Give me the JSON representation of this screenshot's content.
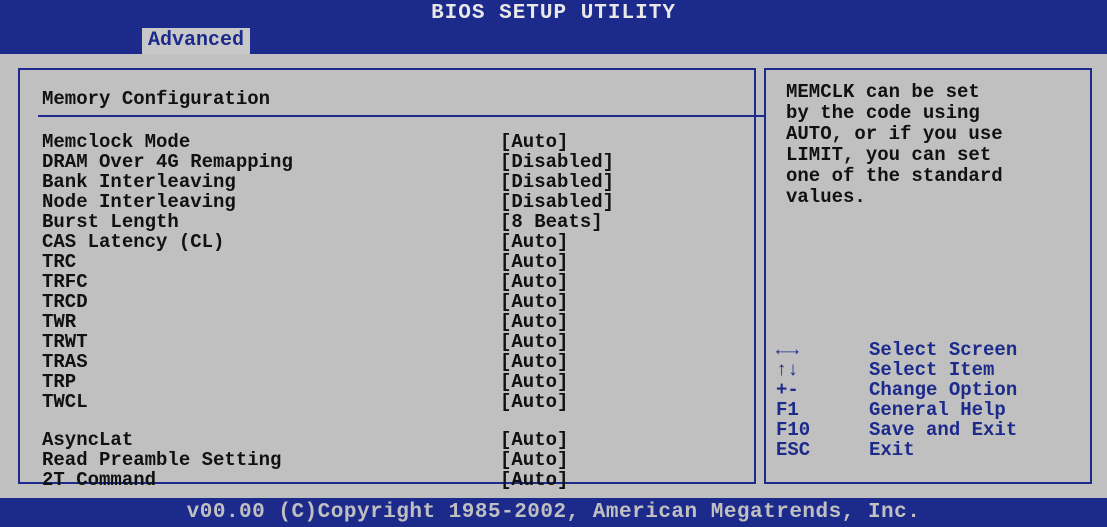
{
  "window": {
    "title": "BIOS SETUP UTILITY"
  },
  "menu": {
    "active_tab": "Advanced"
  },
  "section": {
    "title": "Memory Configuration"
  },
  "settings": [
    {
      "label": "Memclock Mode",
      "value": "[Auto]"
    },
    {
      "label": "DRAM Over 4G Remapping",
      "value": "[Disabled]"
    },
    {
      "label": "Bank Interleaving",
      "value": "[Disabled]"
    },
    {
      "label": "Node Interleaving",
      "value": "[Disabled]"
    },
    {
      "label": "Burst Length",
      "value": "[8 Beats]"
    },
    {
      "label": "CAS Latency (CL)",
      "value": "[Auto]"
    },
    {
      "label": "TRC",
      "value": "[Auto]"
    },
    {
      "label": "TRFC",
      "value": "[Auto]"
    },
    {
      "label": "TRCD",
      "value": "[Auto]"
    },
    {
      "label": "TWR",
      "value": "[Auto]"
    },
    {
      "label": "TRWT",
      "value": "[Auto]"
    },
    {
      "label": "TRAS",
      "value": "[Auto]"
    },
    {
      "label": "TRP",
      "value": "[Auto]"
    },
    {
      "label": "TWCL",
      "value": "[Auto]"
    },
    {
      "label": "AsyncLat",
      "value": "[Auto]"
    },
    {
      "label": "Read Preamble Setting",
      "value": "[Auto]"
    },
    {
      "label": "2T Command",
      "value": "[Auto]"
    }
  ],
  "help": {
    "lines": [
      "MEMCLK can be set",
      "by the code using",
      "AUTO, or if you use",
      "LIMIT, you can set",
      "one of the standard",
      "values."
    ]
  },
  "keys": [
    {
      "key": "←→",
      "desc": "Select Screen"
    },
    {
      "key": "↑↓",
      "desc": "Select Item"
    },
    {
      "key": "+-",
      "desc": "Change Option"
    },
    {
      "key": "F1",
      "desc": "General Help"
    },
    {
      "key": "F10",
      "desc": "Save and Exit"
    },
    {
      "key": "ESC",
      "desc": "Exit"
    }
  ],
  "footer": {
    "text": "v00.00 (C)Copyright 1985-2002, American Megatrends, Inc."
  },
  "colors": {
    "background": "#c0c0c0",
    "accent": "#1c2a8c",
    "tab_bg": "#c8c8c8"
  }
}
